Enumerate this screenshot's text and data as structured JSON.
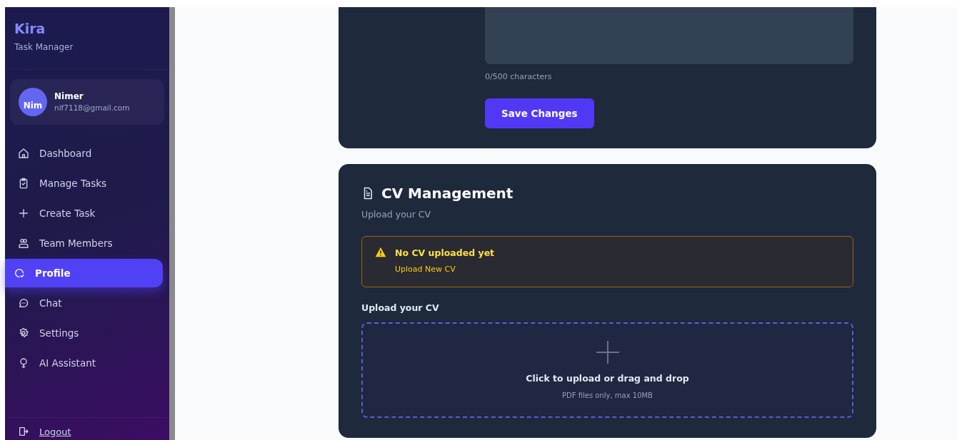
{
  "brand": {
    "title": "Kira",
    "subtitle": "Task Manager"
  },
  "user": {
    "name": "Nimer",
    "email": "nif7118@gmail.com",
    "avatar_text": "Nim"
  },
  "nav": [
    {
      "label": "Dashboard",
      "kind": "home",
      "selected": false
    },
    {
      "label": "Manage Tasks",
      "kind": "tasks",
      "selected": false
    },
    {
      "label": "Create Task",
      "kind": "plus",
      "selected": false
    },
    {
      "label": "Team Members",
      "kind": "team",
      "selected": false
    },
    {
      "label": "Profile",
      "kind": "profile",
      "selected": true
    },
    {
      "label": "Chat",
      "kind": "chat",
      "selected": false
    },
    {
      "label": "Settings",
      "kind": "settings",
      "selected": false
    },
    {
      "label": "AI Assistant",
      "kind": "ai",
      "selected": false
    }
  ],
  "logout": {
    "label": "Logout"
  },
  "bio_card": {
    "counter": "0/500 characters",
    "save_button": "Save Changes"
  },
  "cv_card": {
    "title": "CV Management",
    "subtitle": "Upload your CV",
    "alert": {
      "title": "No CV uploaded yet",
      "link": "Upload New CV"
    },
    "upload_label": "Upload your CV",
    "dropzone": {
      "title": "Click to upload or drag and drop",
      "hint": "PDF files only, max 10MB"
    }
  }
}
